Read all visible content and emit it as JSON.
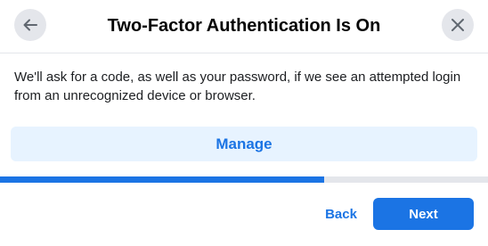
{
  "dialog": {
    "title": "Two-Factor Authentication Is On",
    "back_icon": "arrow-left-icon",
    "close_icon": "close-icon",
    "description": "We'll ask for a code, as well as your password, if we see an attempted login from an unrecognized device or browser.",
    "manage_label": "Manage",
    "progress_fraction": 0.665,
    "footer": {
      "back_label": "Back",
      "next_label": "Next"
    }
  },
  "colors": {
    "accent": "#1b74e4",
    "accent_light": "#e7f3ff",
    "icon_button_bg": "#e4e6eb",
    "text_primary": "#050505"
  }
}
